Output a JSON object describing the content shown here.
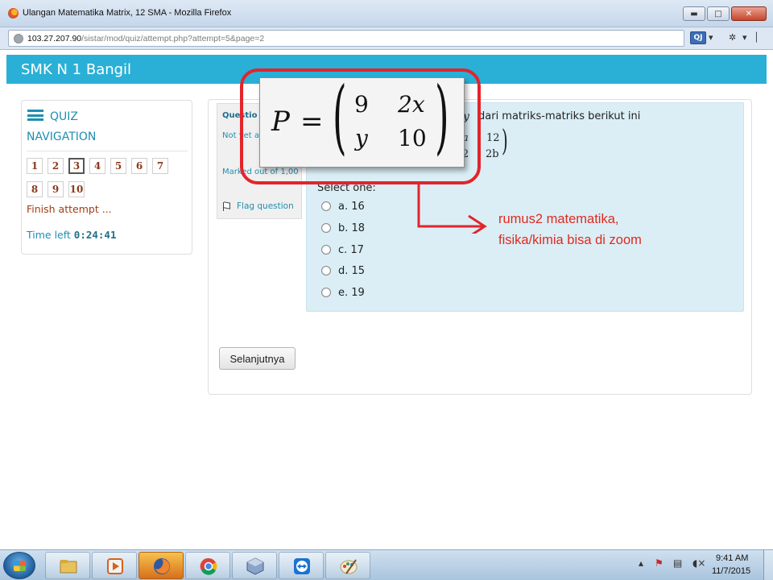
{
  "window": {
    "title": "Ulangan Matematika Matrix, 12 SMA - Mozilla Firefox",
    "minimize": "▬",
    "maximize": "□",
    "close": "✕"
  },
  "urlbar": {
    "host": "103.27.207.90",
    "path": "/sistar/mod/quiz/attempt.php?attempt=5&page=2",
    "addon_label": "QJ"
  },
  "site": {
    "title": "SMK N 1 Bangil"
  },
  "quiz_nav": {
    "title_line1": "QUIZ",
    "title_line2": "NAVIGATION",
    "questions": [
      "1",
      "2",
      "3",
      "4",
      "5",
      "6",
      "7",
      "8",
      "9",
      "10"
    ],
    "current": "3",
    "finish_link": "Finish attempt ...",
    "time_label": "Time left",
    "time_value": "0:24:41"
  },
  "question_info": {
    "title": "Questio",
    "state": "Not yet answered",
    "marks": "Marked out of 1,00",
    "flag": "Flag question"
  },
  "question": {
    "text_var": "y",
    "text_rest": "dari matriks-matriks berikut ini",
    "matrix_left": [
      "a",
      "2"
    ],
    "matrix_right": [
      "12",
      "2b"
    ],
    "select_label": "Select one:",
    "options": [
      "a. 16",
      "b. 18",
      "c. 17",
      "d. 15",
      "e. 19"
    ]
  },
  "next_button": "Selanjutnya",
  "zoomed_formula": {
    "lhs": "P",
    "eq": "=",
    "row1": [
      "9",
      "2x"
    ],
    "row2": [
      "y",
      "10"
    ]
  },
  "annotation": {
    "line1": "rumus2 matematika,",
    "line2": "fisika/kimia  bisa di zoom",
    "color": "#e3242b"
  },
  "taskbar": {
    "time": "9:41 AM",
    "date": "11/7/2015"
  }
}
